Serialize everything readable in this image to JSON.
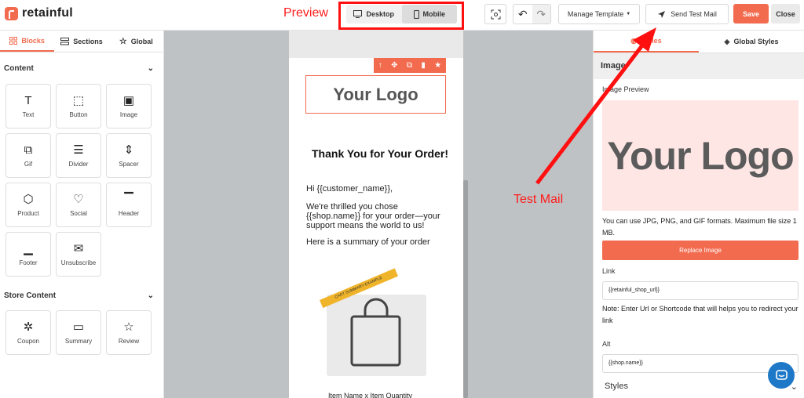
{
  "app": {
    "logo_text": "retainful"
  },
  "annotations": {
    "preview": "Preview",
    "test_mail": "Test Mail"
  },
  "toolbar": {
    "desktop_label": "Desktop",
    "mobile_label": "Mobile",
    "manage_template_label": "Manage Template",
    "send_test_mail_label": "Send Test Mail",
    "save_label": "Save",
    "close_label": "Close"
  },
  "left_panel": {
    "tabs": [
      {
        "label": "Blocks",
        "icon": "grid-icon"
      },
      {
        "label": "Sections",
        "icon": "sections-icon"
      },
      {
        "label": "Global",
        "icon": "star-icon"
      }
    ],
    "content_heading": "Content",
    "content_blocks": [
      {
        "label": "Text",
        "icon": "text-icon"
      },
      {
        "label": "Button",
        "icon": "button-icon"
      },
      {
        "label": "Image",
        "icon": "image-icon"
      },
      {
        "label": "Gif",
        "icon": "gif-icon"
      },
      {
        "label": "Divider",
        "icon": "divider-icon"
      },
      {
        "label": "Spacer",
        "icon": "spacer-icon"
      },
      {
        "label": "Product",
        "icon": "product-icon"
      },
      {
        "label": "Social",
        "icon": "heart-icon"
      },
      {
        "label": "Header",
        "icon": "header-icon"
      },
      {
        "label": "Footer",
        "icon": "footer-icon"
      },
      {
        "label": "Unsubscribe",
        "icon": "unsubscribe-icon"
      }
    ],
    "store_heading": "Store Content",
    "store_blocks": [
      {
        "label": "Coupon",
        "icon": "coupon-icon"
      },
      {
        "label": "Summary",
        "icon": "summary-icon"
      },
      {
        "label": "Review",
        "icon": "star-icon"
      }
    ]
  },
  "email": {
    "logo_text": "Your Logo",
    "title": "Thank You for Your Order!",
    "greeting": "Hi {{customer_name}},",
    "body": "We're thrilled you chose {{shop.name}} for your order—your support means the world to us!",
    "summary_intro": "Here is a summary of your order",
    "ribbon_text": "CART SUMMARY EXAMPLE",
    "item_line": "Item Name x Item Quantity"
  },
  "right_panel": {
    "tabs": [
      {
        "label": "Styles",
        "icon": "palette-icon"
      },
      {
        "label": "Global Styles",
        "icon": "paint-bucket-icon"
      }
    ],
    "section_title": "Image",
    "image_preview_label": "Image Preview",
    "preview_logo_text": "Your Logo",
    "format_note": "You can use JPG, PNG, and GIF formats. Maximum file size 1 MB.",
    "replace_label": "Replace Image",
    "link_label": "Link",
    "link_value": "{{retainful_shop_url}}",
    "link_note": "Note: Enter Url or Shortcode that will helps you to redirect your link",
    "alt_label": "Alt",
    "alt_value": "{{shop.name}}",
    "styles_label": "Styles"
  },
  "colors": {
    "accent": "#f26b4f",
    "annotation": "#ff1a1a",
    "chat": "#1e78c8"
  }
}
